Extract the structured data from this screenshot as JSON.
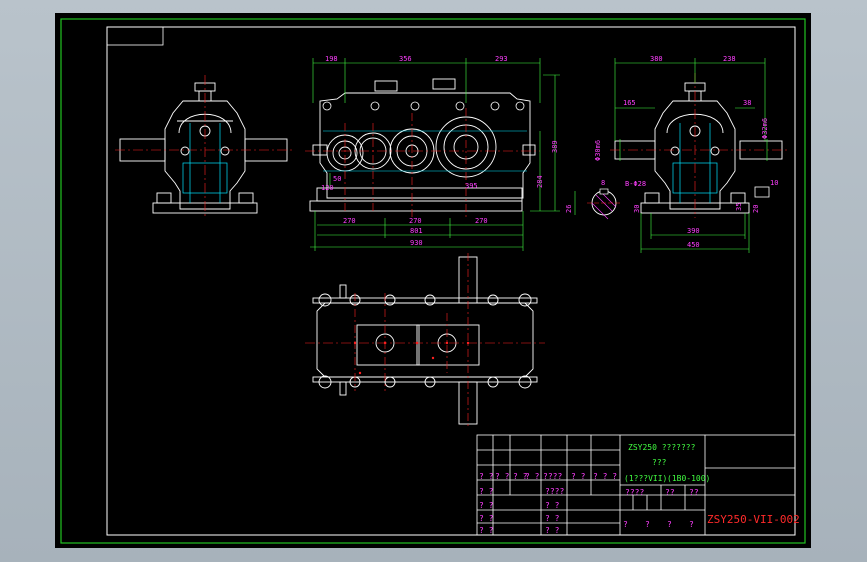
{
  "colors": {
    "background": "#000000",
    "frame": "#ffffff",
    "border_green": "#22c322",
    "outline": "#ffffff",
    "centerline": "#ff2020",
    "dimension": "#ff3fff",
    "hidden": "#00e5ff",
    "title_green": "#42ff42",
    "title_red": "#ff2a2a"
  },
  "front_view": {
    "dims_top": [
      "198",
      "356",
      "293"
    ],
    "dims_bottom": [
      "270",
      "270",
      "270"
    ],
    "overall_length": "801",
    "total_length": "930",
    "height": "389",
    "base_height": "284",
    "left_offset": "50",
    "small_dim": "120",
    "right_offset": "395"
  },
  "side_view": {
    "dims_top": [
      "380",
      "238"
    ],
    "left_offset": "165",
    "right_offset": "38",
    "shaft_left": "Φ30m6",
    "shaft_right": "Φ32m6",
    "base_width": "390",
    "total_width": "450",
    "section_label": "B-Φ28",
    "keyway_width": "8",
    "keyway_depth": "10",
    "shaft_dim": "35",
    "section_dim": "26",
    "small_dim": "30",
    "height_dim": "20"
  },
  "title_block": {
    "product_title": "ZSY250 ???????",
    "subtitle": "???",
    "scale_note": "(1???VII)",
    "ratio_note": "(1B0-100)",
    "mark_a": "????",
    "mark_b": "??",
    "mark_c": "??",
    "drawing_number": "ZSY250-VII-002",
    "header_cells": [
      "? ?",
      "? ?",
      "?????",
      "?????",
      "?????",
      "? ? ?"
    ],
    "row_cells": [
      "? ?",
      "? ?",
      "? ?",
      "? ?",
      "????",
      "? ?",
      "? ? ?"
    ],
    "left_column": [
      "? ?",
      "? ?",
      "? ?",
      "? ?"
    ],
    "mid_column": [
      "????",
      "? ?",
      "? ?",
      "? ?"
    ],
    "bottom_cells": [
      "?",
      "?",
      "?",
      "?"
    ]
  }
}
